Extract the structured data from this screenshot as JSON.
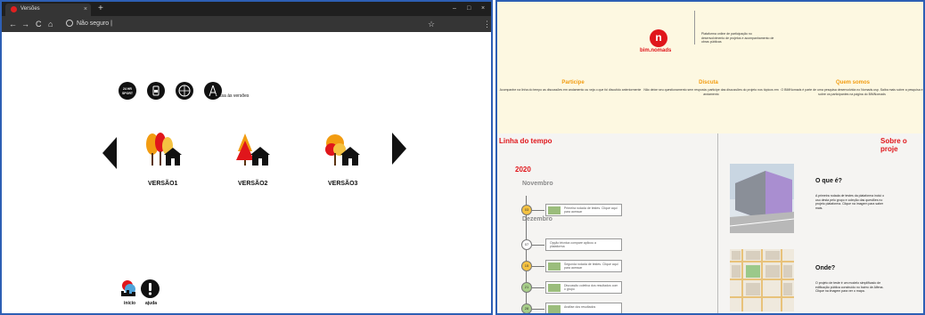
{
  "left_window": {
    "tab_title": "Versões",
    "tab_close": "×",
    "new_tab": "+",
    "window_controls": [
      "–",
      "□",
      "×"
    ],
    "nav": {
      "back": "←",
      "forward": "→",
      "reload": "C",
      "home": "⌂"
    },
    "omnibox_text": "Não seguro |",
    "star": "☆",
    "menu": "⋮",
    "acessa_label": "acessa às versões",
    "versions": [
      "VERSÃO1",
      "VERSÃO2",
      "VERSÃO3"
    ],
    "bottom_labels": [
      "início",
      "ajuda"
    ],
    "colors": {
      "titlebar": "#1f1f1f",
      "toolbar": "#353535",
      "accent": "#e02020"
    }
  },
  "right_page": {
    "logo_letter": "n",
    "logo_text": "bim.nomads",
    "tagline": "Plataforma online de participação no desenvolvimento de projetos e acompanhamento de obras públicas",
    "columns": [
      {
        "title": "Participe",
        "text": "Acompanhe na linha do tempo as discussões em andamento ou veja o que foi discutido anteriormente"
      },
      {
        "title": "Discuta",
        "text": "Não deixe seu questionamento sem resposta: participe das discussões do projeto nos tópicos em andamento"
      },
      {
        "title": "Quem somos",
        "text": "O BIMNomads é parte de uma pesquisa desenvolvida no Nomads.usp. Saiba mais sobre a pesquisa e sobre os participantes na página do BIMNomads"
      }
    ],
    "timeline_title": "Linha do tempo",
    "about_title": "Sobre o proje",
    "year": "2020",
    "months": [
      "Novembro",
      "Dezembro"
    ],
    "timeline_items": [
      {
        "dot": "03",
        "text": "Primeira rodada de testes. Clique aqui para acessar"
      },
      {
        "dot": "07",
        "text": "Opção técnica compare aplicou a plataforma"
      },
      {
        "dot": "15",
        "text": "Segunda rodada de testes. Clique aqui para acessar"
      },
      {
        "dot": "21",
        "text": "Discussão coletiva dos resultados com o grupo"
      },
      {
        "dot": "28",
        "text": "Análise dos resultados"
      }
    ],
    "what": {
      "title": "O que é?",
      "text": "A primeira rodada de testes da plataforma inclui o uso desta pelo grupo e coleção das questões no projeto plataforma. Clique na imagem para saber mais."
    },
    "where": {
      "title": "Onde?",
      "text": "O projeto de teste é um modelo simplificado de edificação pública construído no bairro de Alfena. Clique na imagem para ver o mapa."
    },
    "colors": {
      "background": "#fdf8e1",
      "accent_red": "#e0161b",
      "accent_orange": "#f29c11"
    }
  }
}
